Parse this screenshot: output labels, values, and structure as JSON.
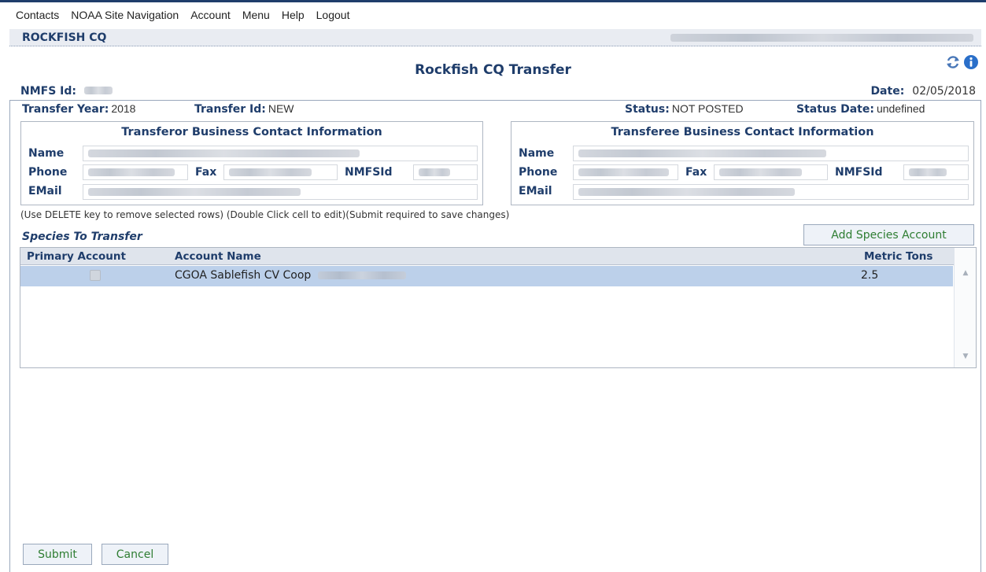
{
  "menu": {
    "items": [
      "Contacts",
      "NOAA Site Navigation",
      "Account",
      "Menu",
      "Help",
      "Logout"
    ]
  },
  "header": {
    "app_title": "ROCKFISH CQ"
  },
  "page": {
    "title": "Rockfish CQ Transfer",
    "nmfs_id_label": "NMFS Id:",
    "date_label": "Date:",
    "date_value": "02/05/2018",
    "transfer_year_label": "Transfer Year:",
    "transfer_year_value": "2018",
    "transfer_id_label": "Transfer Id:",
    "transfer_id_value": "NEW",
    "status_label": "Status:",
    "status_value": "NOT POSTED",
    "status_date_label": "Status Date:",
    "status_date_value": "undefined"
  },
  "transferor": {
    "title": "Transferor Business Contact Information",
    "name_label": "Name",
    "phone_label": "Phone",
    "fax_label": "Fax",
    "nmfsid_label": "NMFSId",
    "email_label": "EMail"
  },
  "transferee": {
    "title": "Transferee Business Contact Information",
    "name_label": "Name",
    "phone_label": "Phone",
    "fax_label": "Fax",
    "nmfsid_label": "NMFSId",
    "email_label": "EMail"
  },
  "hint_text": "(Use DELETE key to remove selected rows) (Double Click cell to edit)(Submit required to save changes)",
  "species": {
    "section_title": "Species To Transfer",
    "add_button_label": "Add Species Account",
    "columns": [
      "Primary Account",
      "Account Name",
      "Metric Tons"
    ],
    "rows": [
      {
        "primary": false,
        "account_name": "CGOA Sablefish CV Coop",
        "metric_tons": "2.5"
      }
    ]
  },
  "actions": {
    "submit_label": "Submit",
    "cancel_label": "Cancel"
  },
  "colors": {
    "brand_blue": "#1f3d6b",
    "selected_row": "#bcd0ea",
    "button_text_green": "#2e7d32"
  },
  "icons": [
    "refresh-icon",
    "info-icon",
    "scroll-up-icon",
    "scroll-down-icon"
  ]
}
